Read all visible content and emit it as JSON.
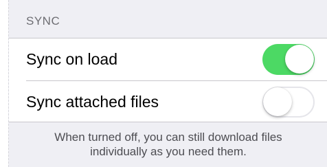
{
  "section": {
    "header": "SYNC"
  },
  "settings": [
    {
      "label": "Sync on load",
      "enabled": true
    },
    {
      "label": "Sync attached files",
      "enabled": false
    }
  ],
  "footer": {
    "line1": "When turned off, you can still download files",
    "line2": "individually as you need them."
  },
  "colors": {
    "toggle_on": "#4cd964",
    "background": "#efeff4"
  }
}
